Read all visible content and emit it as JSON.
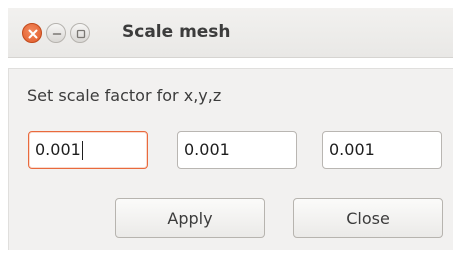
{
  "window": {
    "title": "Scale mesh",
    "controls": [
      "close-icon",
      "minimize-icon",
      "maximize-icon"
    ],
    "accent_color": "#e05a29"
  },
  "form": {
    "prompt": "Set scale factor for x,y,z",
    "x_value": "0.001",
    "y_value": "0.001",
    "z_value": "0.001",
    "focused_field": "x"
  },
  "buttons": {
    "apply_label": "Apply",
    "close_label": "Close"
  }
}
